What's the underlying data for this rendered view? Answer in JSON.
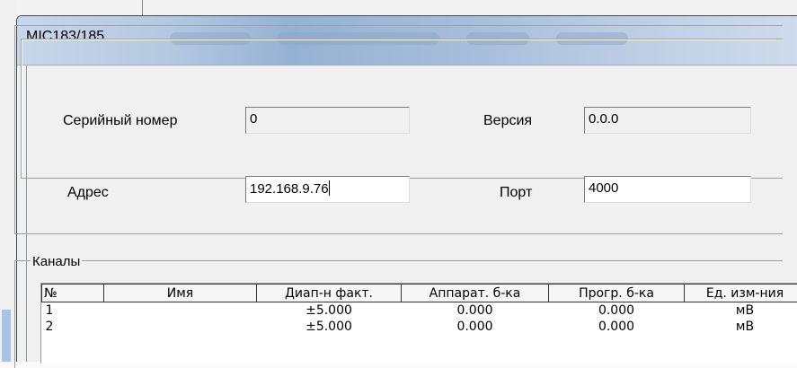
{
  "window": {
    "title": "MIC183/185"
  },
  "device": {
    "serial_label": "Серийный номер",
    "serial_value": "0",
    "version_label": "Версия",
    "version_value": "0.0.0",
    "address_label": "Адрес",
    "address_value": "192.168.9.76",
    "port_label": "Порт",
    "port_value": "4000"
  },
  "channels": {
    "legend": "Каналы",
    "columns": [
      "№",
      "Имя",
      "Диап-н факт.",
      "Аппарат. б-ка",
      "Прогр. б-ка",
      "Ед. изм-ния"
    ],
    "rows": [
      [
        "1",
        "",
        "±5.000",
        "0.000",
        "0.000",
        "мВ"
      ],
      [
        "2",
        "",
        "±5.000",
        "0.000",
        "0.000",
        "мВ"
      ]
    ]
  }
}
